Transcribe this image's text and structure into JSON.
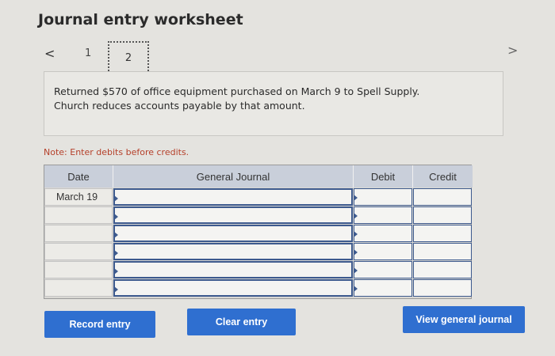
{
  "title": "Journal entry worksheet",
  "nav": {
    "prev_icon": "<",
    "next_icon": ">",
    "steps": [
      "1",
      "2"
    ],
    "active_step": "2"
  },
  "description": {
    "line1": "Returned $570 of office equipment purchased on March 9 to Spell Supply.",
    "line2": "Church reduces accounts payable by that amount."
  },
  "note": "Note: Enter debits before credits.",
  "journal": {
    "headers": {
      "date": "Date",
      "general_journal": "General Journal",
      "debit": "Debit",
      "credit": "Credit"
    },
    "rows": [
      {
        "date": "March 19",
        "account": "",
        "debit": "",
        "credit": ""
      },
      {
        "date": "",
        "account": "",
        "debit": "",
        "credit": ""
      },
      {
        "date": "",
        "account": "",
        "debit": "",
        "credit": ""
      },
      {
        "date": "",
        "account": "",
        "debit": "",
        "credit": ""
      },
      {
        "date": "",
        "account": "",
        "debit": "",
        "credit": ""
      },
      {
        "date": "",
        "account": "",
        "debit": "",
        "credit": ""
      }
    ]
  },
  "buttons": {
    "record": "Record entry",
    "clear": "Clear entry",
    "view": "View general journal"
  },
  "colors": {
    "button": "#2f6fd0",
    "header": "#c9cfda",
    "note": "#b5402a"
  }
}
